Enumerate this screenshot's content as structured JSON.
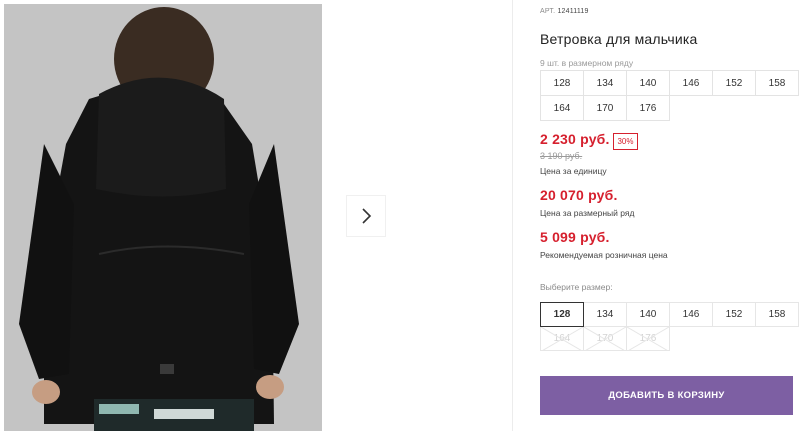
{
  "product": {
    "article_label": "АРТ.",
    "article_number": "12411119",
    "title": "Ветровка для мальчика",
    "range_note": "9 шт. в размерном ряду",
    "size_range": [
      "128",
      "134",
      "140",
      "146",
      "152",
      "158",
      "164",
      "170",
      "176"
    ]
  },
  "pricing": {
    "unit_price": "2 230 руб.",
    "discount_badge": "30%",
    "old_price": "3 190 руб.",
    "unit_caption": "Цена за единицу",
    "range_price": "20 070 руб.",
    "range_caption": "Цена за размерный ряд",
    "retail_price": "5 099 руб.",
    "retail_caption": "Рекомендуемая розничная цена"
  },
  "size_picker": {
    "label": "Выберите размер:",
    "selected": "128",
    "available": [
      "128",
      "134",
      "140",
      "146",
      "152",
      "158"
    ],
    "unavailable": [
      "164",
      "170",
      "176"
    ]
  },
  "actions": {
    "add_to_cart": "ДОБАВИТЬ В КОРЗИНУ"
  },
  "gallery": {
    "next_icon": "chevron-right-icon"
  },
  "colors": {
    "accent_purple": "#7d5fa3",
    "price_red": "#d6202e"
  }
}
